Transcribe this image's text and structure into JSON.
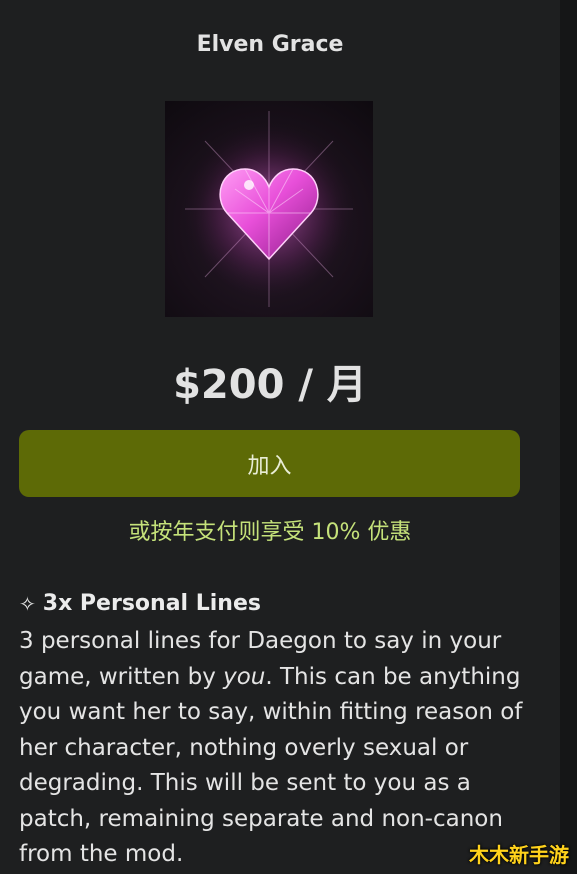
{
  "tier": {
    "title": "Elven Grace",
    "image_icon": "pink-heart-gem-icon",
    "price": "$200 / 月",
    "join_label": "加入",
    "annual_discount": "或按年支付则享受 10% 优惠"
  },
  "benefit": {
    "icon": "sparkle-icon",
    "icon_glyph": "✧",
    "title": "3x Personal Lines",
    "desc_before": "3 personal lines for Daegon to say in your game, written by ",
    "desc_emph": "you",
    "desc_after": ". This can be anything you want her to say, within fitting reason of her character, nothing overly sexual or degrading. This will be sent to you as a patch, remaining separate and non-canon from the mod."
  },
  "watermark": "木木新手游",
  "colors": {
    "background": "#1e1f20",
    "join_button": "#5d6a06",
    "discount_text": "#c5e27a",
    "gem": "#e44fd8"
  }
}
